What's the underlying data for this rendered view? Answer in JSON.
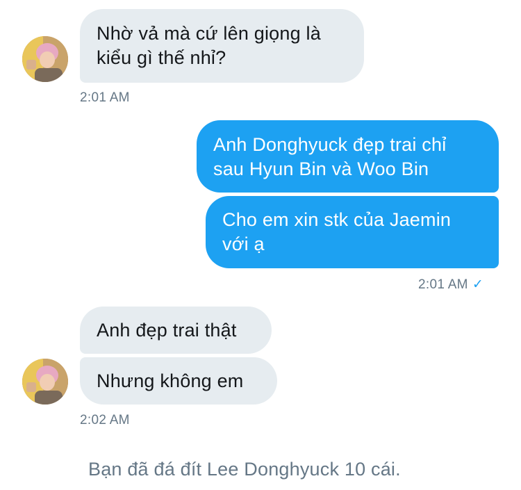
{
  "conversation": {
    "messages": [
      {
        "sender": "other",
        "text": "Nhờ vả mà cứ lên giọng là kiểu gì thế nhỉ?"
      },
      {
        "sender": "me",
        "text": "Anh Donghyuck đẹp trai chỉ sau Hyun Bin và Woo Bin"
      },
      {
        "sender": "me",
        "text": "Cho em xin stk của Jaemin với ạ"
      },
      {
        "sender": "other",
        "text": "Anh đẹp trai thật"
      },
      {
        "sender": "other",
        "text": "Nhưng không em"
      }
    ],
    "timestamps": {
      "first": "2:01 AM",
      "second": "2:01 AM",
      "third": "2:02 AM"
    },
    "read_receipt_icon": "checkmark-icon",
    "system_message": "Bạn đã đá đít Lee Donghyuck 10 cái."
  },
  "colors": {
    "incoming_bubble": "#e6ecf0",
    "outgoing_bubble": "#1da1f2",
    "timestamp": "#657786",
    "text": "#14171a"
  }
}
